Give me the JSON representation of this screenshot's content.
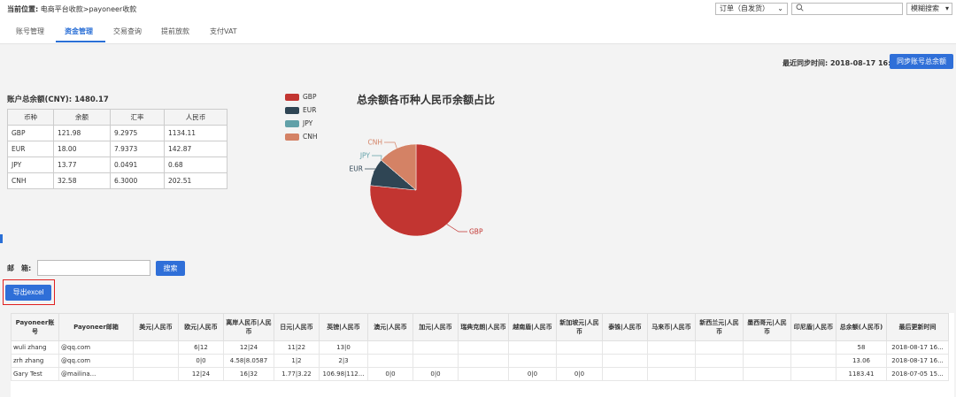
{
  "topbar": {
    "crumb_label": "当前位置:",
    "crumb_path": "电商平台收款>payoneer收款",
    "order_select": "订单（自发货）",
    "search_placeholder": "",
    "fuzzy_search": "模糊搜索"
  },
  "tabs": [
    {
      "label": "账号管理"
    },
    {
      "label": "资金管理"
    },
    {
      "label": "交易查询"
    },
    {
      "label": "提前放款"
    },
    {
      "label": "支付VAT"
    }
  ],
  "sync": {
    "label": "最近同步时间: 2018-08-17 16:59",
    "button": "同步账号总余额"
  },
  "balance": {
    "label": "账户总余额(CNY): 1480.17"
  },
  "currency_table": {
    "headers": [
      "币种",
      "余额",
      "汇率",
      "人民币"
    ],
    "rows": [
      [
        "GBP",
        "121.98",
        "9.2975",
        "1134.11"
      ],
      [
        "EUR",
        "18.00",
        "7.9373",
        "142.87"
      ],
      [
        "JPY",
        "13.77",
        "0.0491",
        "0.68"
      ],
      [
        "CNH",
        "32.58",
        "6.3000",
        "202.51"
      ]
    ]
  },
  "chart_data": {
    "type": "pie",
    "title": "总余额各币种人民币余额占比",
    "labels": [
      "GBP",
      "EUR",
      "JPY",
      "CNH"
    ],
    "values": [
      1134.11,
      142.87,
      0.68,
      202.51
    ],
    "colors": [
      "#c23531",
      "#2f4554",
      "#61a0a8",
      "#d48265"
    ],
    "legend_position": "top-left"
  },
  "filter": {
    "mail_label": "邮　箱:",
    "mail_value": "",
    "search_button": "搜索",
    "export_button": "导出excel"
  },
  "accounts_table": {
    "headers": [
      "Payoneer账号",
      "Payoneer邮箱",
      "美元|人民币",
      "欧元|人民币",
      "离岸人民币|人民币",
      "日元|人民币",
      "英镑|人民币",
      "澳元|人民币",
      "加元|人民币",
      "瑞典克朗|人民币",
      "越南盾|人民币",
      "新加坡元|人民币",
      "泰铢|人民币",
      "马来币|人民币",
      "新西兰元|人民币",
      "墨西哥元|人民币",
      "印尼盾|人民币",
      "总余额(人民币)",
      "最后更新时间"
    ],
    "rows": [
      [
        "wuli zhang",
        "@qq.com",
        "",
        "6|12",
        "12|24",
        "11|22",
        "13|0",
        "",
        "",
        "",
        "",
        "",
        "",
        "",
        "",
        "",
        "",
        "58",
        "2018-08-17 16..."
      ],
      [
        "zrh zhang",
        "@qq.com",
        "",
        "0|0",
        "4.58|8.0587",
        "1|2",
        "2|3",
        "",
        "",
        "",
        "",
        "",
        "",
        "",
        "",
        "",
        "",
        "13.06",
        "2018-08-17 16..."
      ],
      [
        "Gary Test",
        "@mailina...",
        "",
        "12|24",
        "16|32",
        "1.77|3.22",
        "106.98|112...",
        "0|0",
        "0|0",
        "",
        "0|0",
        "0|0",
        "",
        "",
        "",
        "",
        "",
        "1183.41",
        "2018-07-05 15..."
      ]
    ]
  }
}
